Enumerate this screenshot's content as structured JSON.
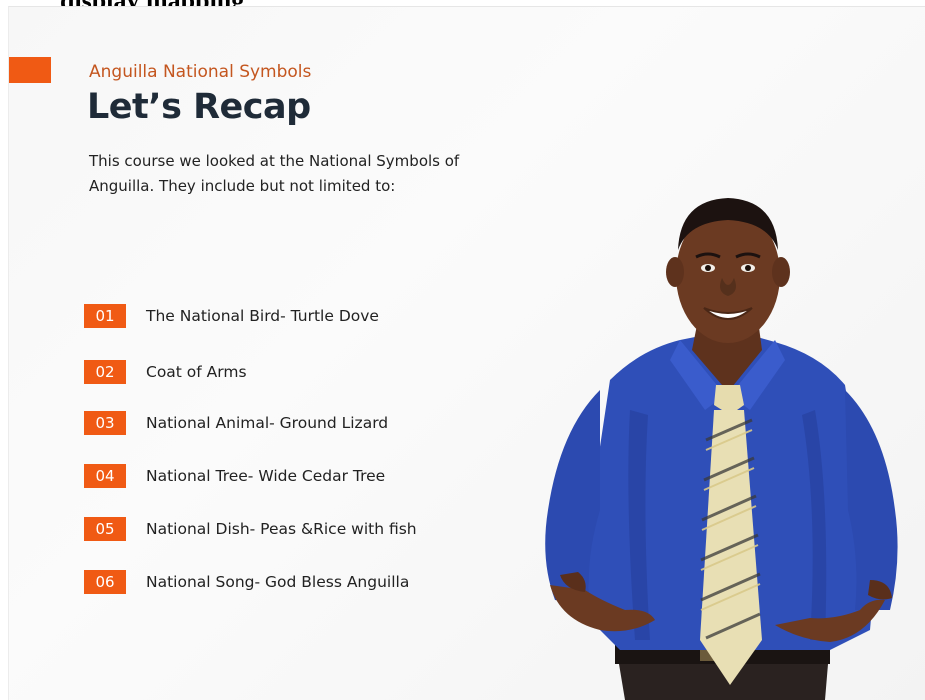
{
  "header": {
    "cut_text": "display mapping"
  },
  "slide": {
    "subtitle": "Anguilla National Symbols",
    "title": "Let’s Recap",
    "intro": "This course we looked at the National Symbols of Anguilla. They include but not limited to:",
    "items": [
      {
        "number": "01",
        "label": "The National Bird- Turtle Dove"
      },
      {
        "number": "02",
        "label": "Coat of Arms"
      },
      {
        "number": "03",
        "label": "National Animal- Ground Lizard"
      },
      {
        "number": "04",
        "label": "National Tree- Wide Cedar Tree"
      },
      {
        "number": "05",
        "label": "National Dish- Peas &Rice with fish"
      },
      {
        "number": "06",
        "label": "National Song- God Bless Anguilla"
      }
    ]
  },
  "colors": {
    "accent": "#f05a14",
    "subtitle": "#c4561f",
    "title": "#1f2b38",
    "shirt": "#2f4fb8",
    "tie": "#e8dfb4"
  }
}
